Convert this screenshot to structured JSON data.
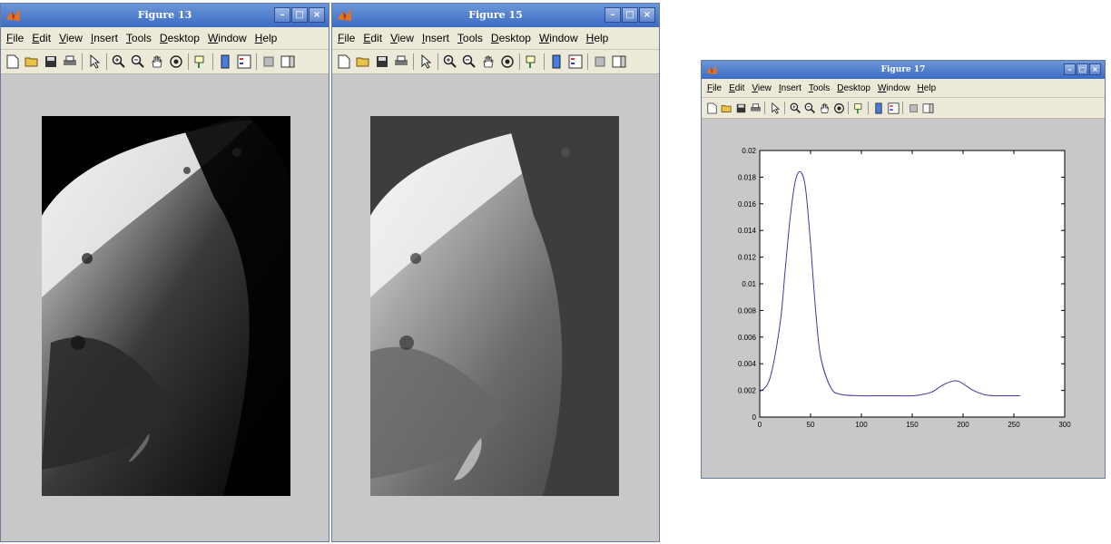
{
  "windows": [
    {
      "title": "Figure 13"
    },
    {
      "title": "Figure 15"
    },
    {
      "title": "Figure 17"
    }
  ],
  "menu": [
    "File",
    "Edit",
    "View",
    "Insert",
    "Tools",
    "Desktop",
    "Window",
    "Help"
  ],
  "window_controls": {
    "minimize": "–",
    "maximize": "□",
    "close": "×"
  },
  "toolbar_icons": [
    "new-file-icon",
    "open-folder-icon",
    "save-icon",
    "print-icon",
    "arrow-pointer-icon",
    "zoom-in-icon",
    "zoom-out-icon",
    "pan-hand-icon",
    "rotate-3d-icon",
    "data-cursor-icon",
    "colorbar-icon",
    "legend-icon",
    "hide-plot-tools-icon",
    "show-plot-tools-icon"
  ],
  "colors": {
    "titlebar": "#3b6bc4",
    "menubar": "#ece9d8",
    "figure_bg": "#c8c8c8",
    "plot_line": "#3a3aa0"
  },
  "chart_data": {
    "type": "line",
    "title": "",
    "xlabel": "",
    "ylabel": "",
    "xlim": [
      0,
      300
    ],
    "ylim": [
      0,
      0.02
    ],
    "xticks": [
      "0",
      "50",
      "100",
      "150",
      "200",
      "250",
      "300"
    ],
    "yticks": [
      "0",
      "0.002",
      "0.004",
      "0.006",
      "0.008",
      "0.01",
      "0.012",
      "0.014",
      "0.016",
      "0.018",
      "0.02"
    ],
    "grid": false,
    "series": [
      {
        "x": [
          0,
          10,
          20,
          25,
          30,
          35,
          40,
          45,
          50,
          55,
          60,
          70,
          80,
          100,
          120,
          150,
          160,
          170,
          180,
          190,
          195,
          200,
          210,
          220,
          230,
          240,
          256
        ],
        "y": [
          0.0019,
          0.0029,
          0.007,
          0.011,
          0.015,
          0.0177,
          0.0184,
          0.0172,
          0.013,
          0.008,
          0.0045,
          0.0022,
          0.0017,
          0.0016,
          0.0016,
          0.0016,
          0.0017,
          0.0019,
          0.0024,
          0.0027,
          0.0027,
          0.0025,
          0.002,
          0.0017,
          0.0016,
          0.0016,
          0.0016
        ]
      }
    ]
  }
}
